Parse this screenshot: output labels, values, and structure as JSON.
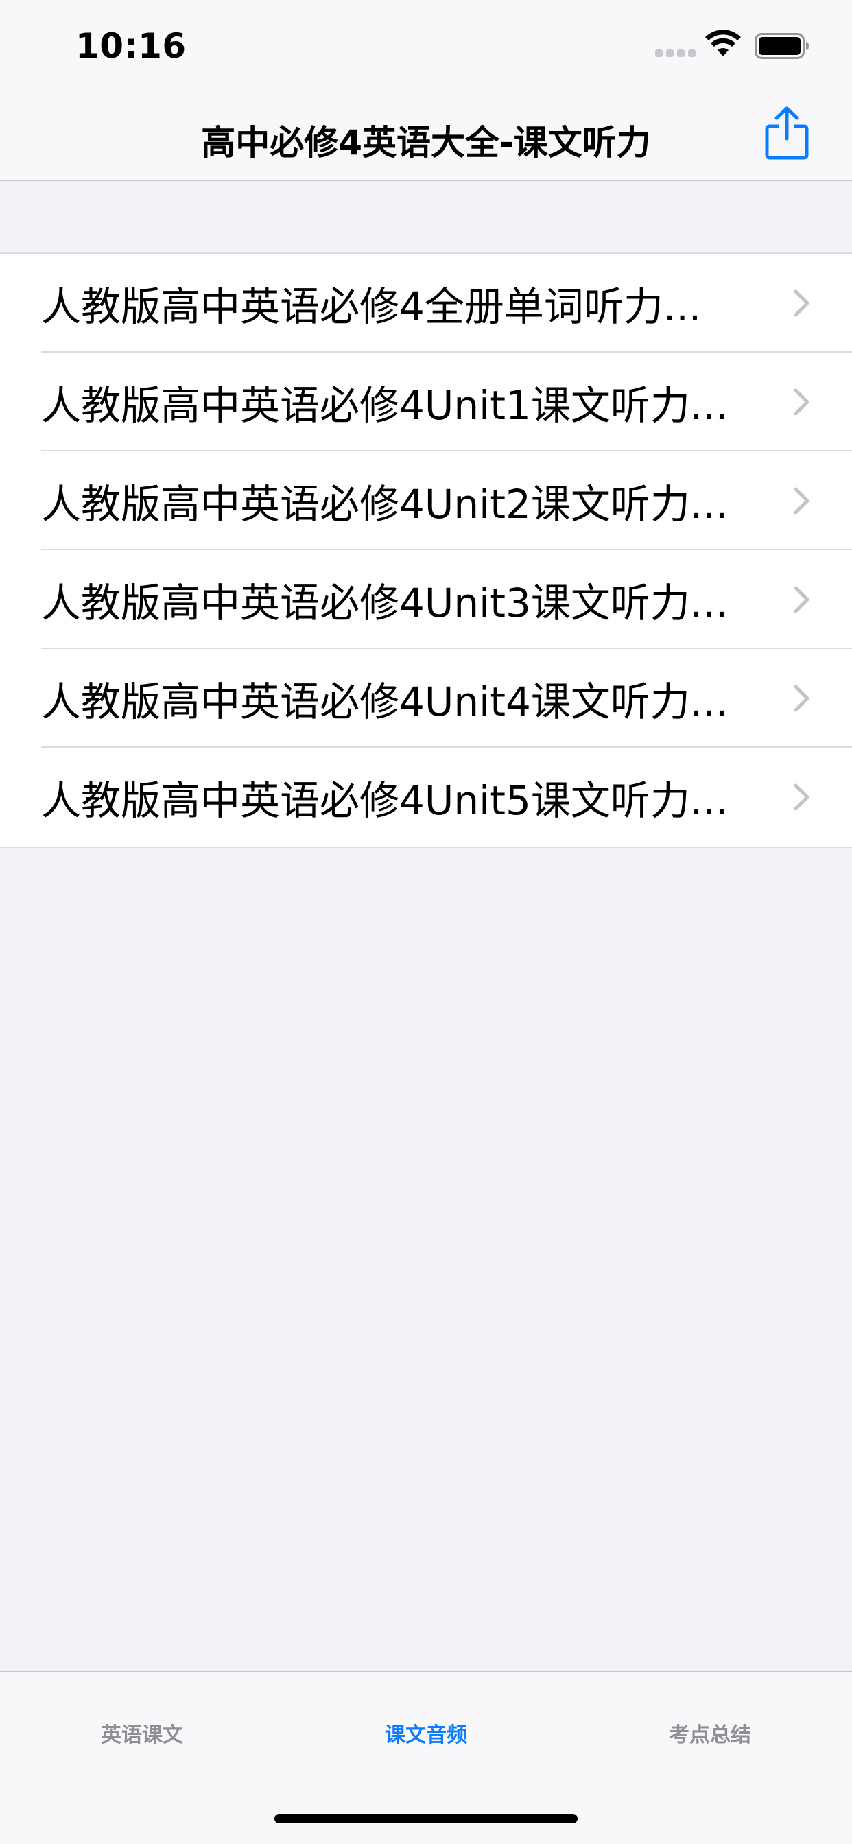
{
  "status": {
    "time": "10:16"
  },
  "nav": {
    "title": "高中必修4英语大全-课文听力"
  },
  "list": {
    "items": [
      "人教版高中英语必修4全册单词听力...",
      "人教版高中英语必修4Unit1课文听力...",
      "人教版高中英语必修4Unit2课文听力...",
      "人教版高中英语必修4Unit3课文听力...",
      "人教版高中英语必修4Unit4课文听力...",
      "人教版高中英语必修4Unit5课文听力..."
    ]
  },
  "tabs": [
    {
      "label": "英语课文",
      "active": false
    },
    {
      "label": "课文音频",
      "active": true
    },
    {
      "label": "考点总结",
      "active": false
    }
  ],
  "colors": {
    "accent": "#0a7cff",
    "inactive": "#8e8e93"
  }
}
